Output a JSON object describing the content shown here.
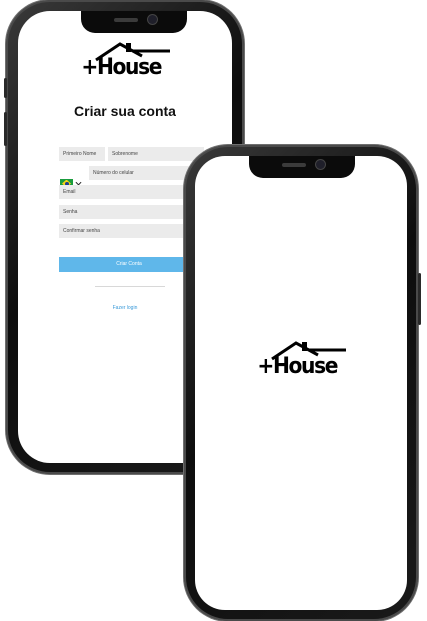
{
  "brand": {
    "logo_text": "+House"
  },
  "signup": {
    "title": "Criar sua conta",
    "first_name_placeholder": "Primeiro Nome",
    "last_name_placeholder": "Sobrenome",
    "phone_placeholder": "Número do celular",
    "email_placeholder": "Email",
    "password_placeholder": "Senha",
    "confirm_password_placeholder": "Confirmar senha",
    "create_button_label": "Criar Conta",
    "login_link_label": "Fazer login",
    "country_flag_icon": "brazil-flag-icon",
    "create_button_color": "#5fb7ea",
    "login_link_color": "#3a9ad9"
  },
  "splash": {
    "logo_text": "+House"
  }
}
